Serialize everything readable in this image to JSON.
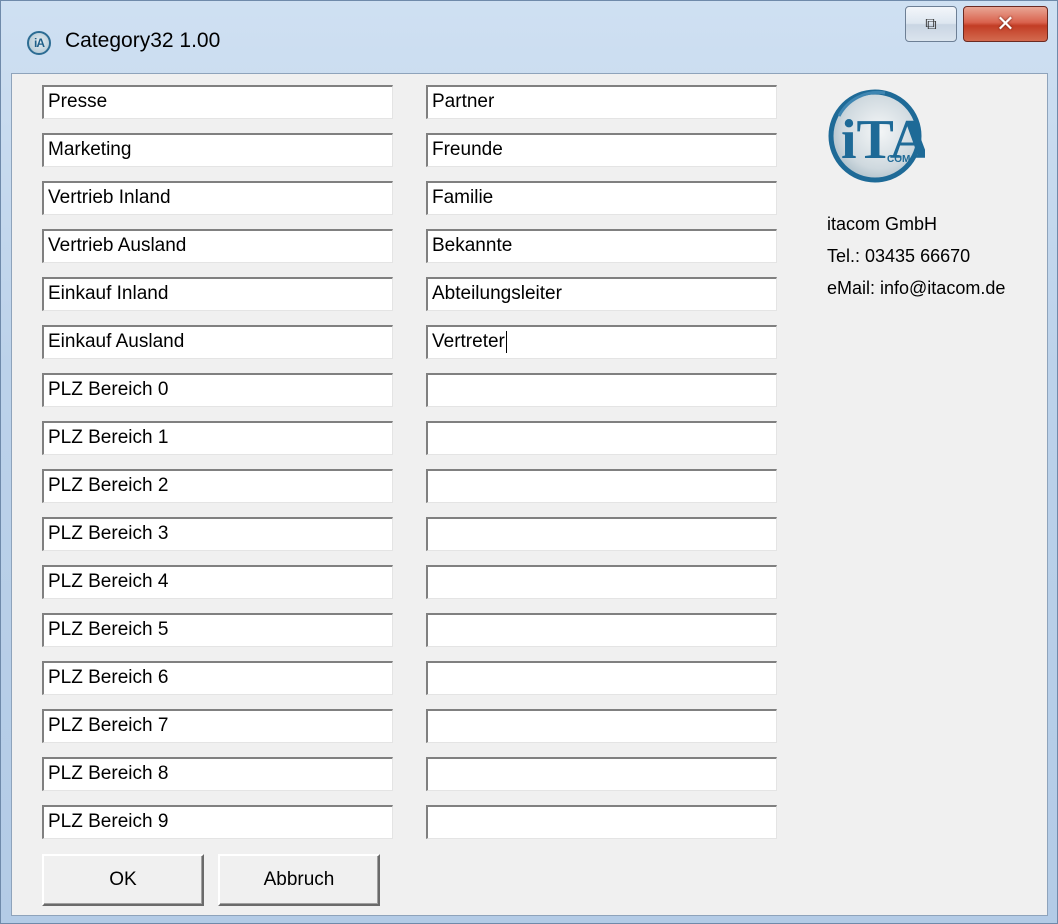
{
  "window": {
    "title": "Category32 1.00",
    "icon_text": "iA",
    "restore_glyph": "⧉",
    "close_glyph": "✕"
  },
  "categories_left": [
    "Presse",
    "Marketing",
    "Vertrieb Inland",
    "Vertrieb Ausland",
    "Einkauf Inland",
    "Einkauf Ausland",
    "PLZ Bereich 0",
    "PLZ Bereich 1",
    "PLZ Bereich 2",
    "PLZ Bereich 3",
    "PLZ Bereich 4",
    "PLZ Bereich 5",
    "PLZ Bereich 6",
    "PLZ Bereich 7",
    "PLZ Bereich 8",
    "PLZ Bereich 9"
  ],
  "categories_right": [
    "Partner",
    "Freunde",
    "Familie",
    "Bekannte",
    "Abteilungsleiter",
    "Vertreter",
    "",
    "",
    "",
    "",
    "",
    "",
    "",
    "",
    "",
    ""
  ],
  "company": {
    "logo_text": "iTA",
    "logo_subtext": "COM",
    "name": "itacom GmbH",
    "phone": "Tel.: 03435 66670",
    "email": "eMail: info@itacom.de"
  },
  "buttons": {
    "ok": "OK",
    "cancel": "Abbruch"
  },
  "colors": {
    "titlebar": "#bcd2ea",
    "client_bg": "#f0f0f0",
    "close_button": "#c23d25",
    "logo_blue": "#1e6a97"
  }
}
